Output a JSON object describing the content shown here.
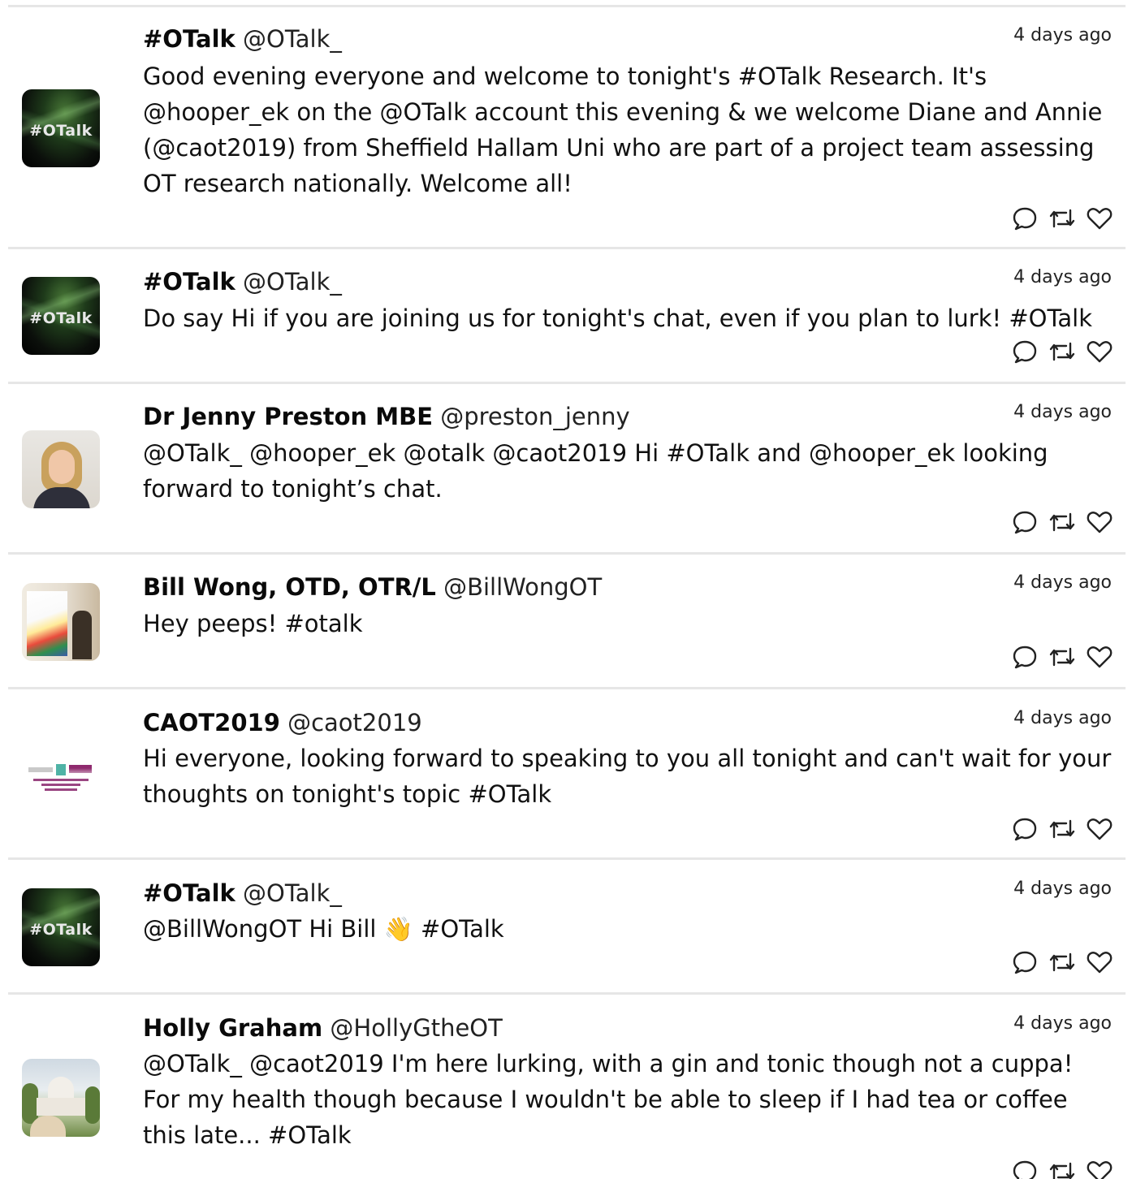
{
  "tweets": [
    {
      "avatar": "otalk-logo",
      "avatar_text": "#OTalk",
      "name": "#OTalk",
      "handle": "@OTalk_",
      "time": "4 days ago",
      "text": "Good evening everyone and welcome to tonight's #OTalk Research. It's @hooper_ek on the @OTalk account this evening & we welcome Diane and Annie (@caot2019) from Sheffield Hallam Uni who are part of a project team assessing OT research nationally. Welcome all!"
    },
    {
      "avatar": "otalk-logo",
      "avatar_text": "#OTalk",
      "name": "#OTalk",
      "handle": "@OTalk_",
      "time": "4 days ago",
      "text": "Do say Hi if you are joining us for tonight's chat, even if you plan to lurk! #OTalk"
    },
    {
      "avatar": "photo-woman",
      "name": "Dr Jenny Preston MBE",
      "handle": "@preston_jenny",
      "time": "4 days ago",
      "text": "@OTalk_ @hooper_ek @otalk @caot2019 Hi #OTalk and @hooper_ek looking forward to tonight’s chat."
    },
    {
      "avatar": "photo-man-poster",
      "name": "Bill Wong, OTD, OTR/L",
      "handle": "@BillWongOT",
      "time": "4 days ago",
      "text": "Hey peeps! #otalk"
    },
    {
      "avatar": "caot-logo",
      "name": "CAOT2019",
      "handle": "@caot2019",
      "time": "4 days ago",
      "text": "Hi everyone, looking forward to speaking to you all tonight and can't wait for your thoughts on tonight's topic #OTalk"
    },
    {
      "avatar": "otalk-logo",
      "avatar_text": "#OTalk",
      "name": "#OTalk",
      "handle": "@OTalk_",
      "time": "4 days ago",
      "text": "@BillWongOT Hi Bill 👋 #OTalk"
    },
    {
      "avatar": "photo-taj-mahal",
      "name": "Holly Graham",
      "handle": "@HollyGtheOT",
      "time": "4 days ago",
      "text": "@OTalk_ @caot2019 I'm here lurking, with a gin and tonic though not a cuppa! For my health though because I wouldn't be able to sleep if I had tea or coffee this late... #OTalk"
    }
  ],
  "actions": [
    "reply-icon",
    "retweet-icon",
    "like-icon"
  ],
  "colors": {
    "divider": "#e6e6e6",
    "text": "#111111",
    "icon": "#222222"
  }
}
